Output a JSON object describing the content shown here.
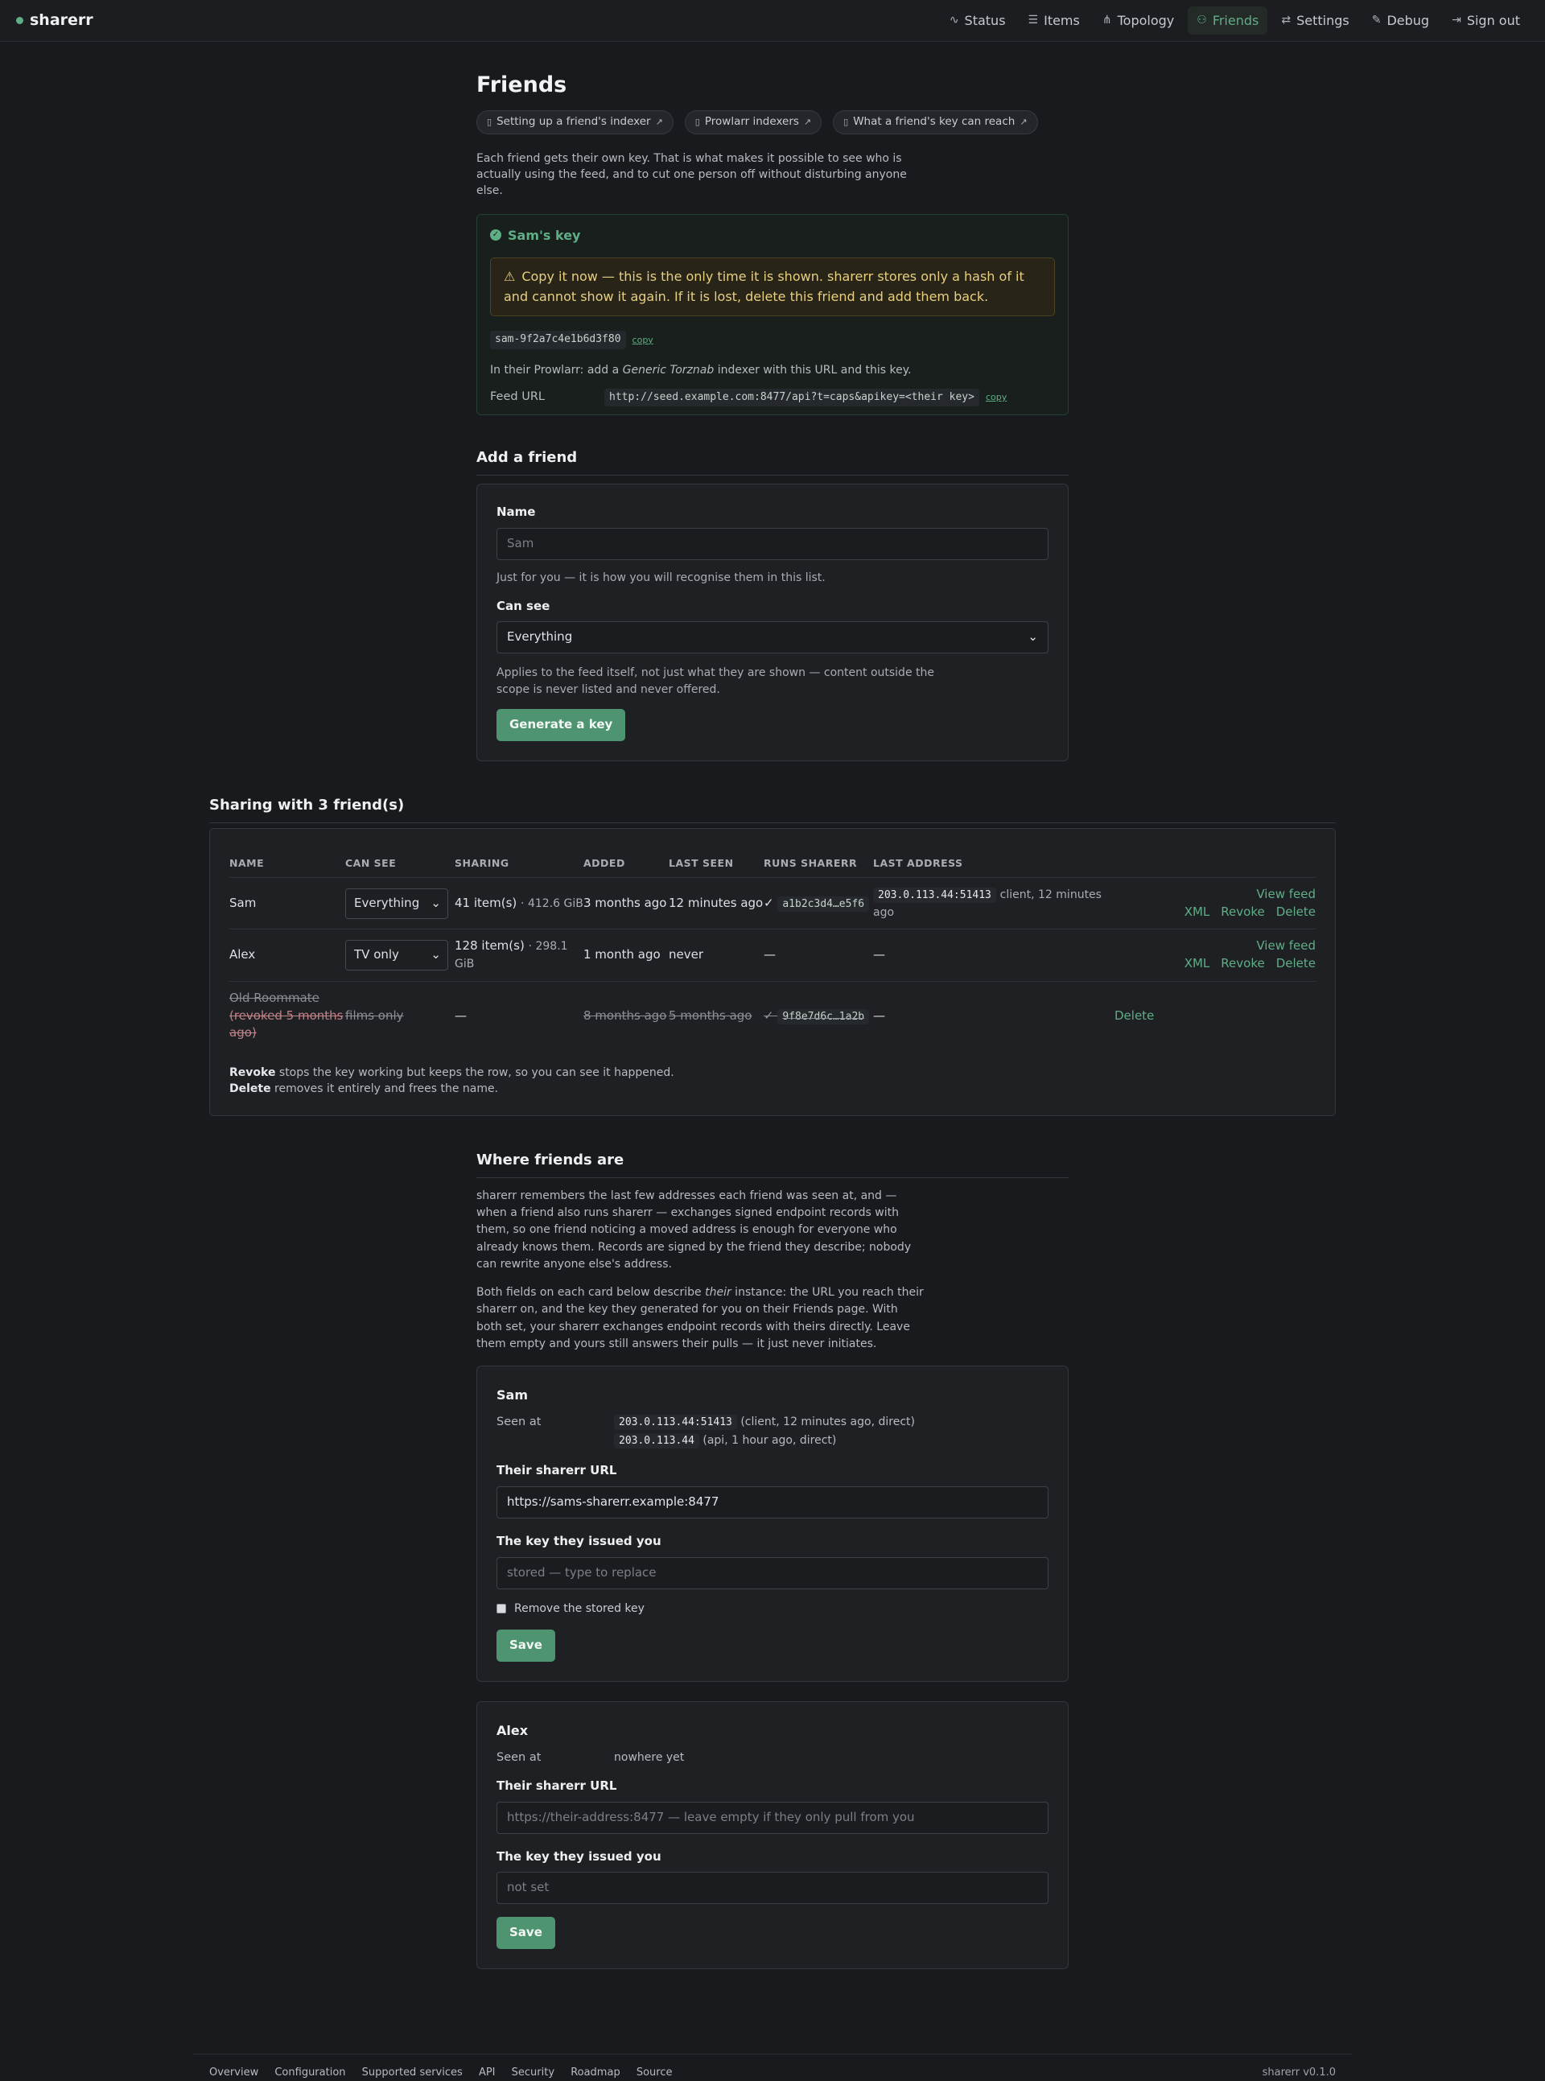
{
  "nav": {
    "brand": "sharerr",
    "links": [
      {
        "label": "Status",
        "icon": "pulse-icon"
      },
      {
        "label": "Items",
        "icon": "list-icon"
      },
      {
        "label": "Topology",
        "icon": "topology-icon"
      },
      {
        "label": "Friends",
        "icon": "friends-icon",
        "active": true
      },
      {
        "label": "Settings",
        "icon": "sliders-icon"
      },
      {
        "label": "Debug",
        "icon": "wrench-icon"
      },
      {
        "label": "Sign out",
        "icon": "sign-out-icon"
      }
    ]
  },
  "page": {
    "title": "Friends",
    "doc_chips": [
      "Setting up a friend's indexer",
      "Prowlarr indexers",
      "What a friend's key can reach"
    ],
    "intro": "Each friend gets their own key. That is what makes it possible to see who is actually using the feed, and to cut one person off without disturbing anyone else."
  },
  "new_key": {
    "title": "Sam's key",
    "warning": "Copy it now — this is the only time it is shown. sharerr stores only a hash of it and cannot show it again. If it is lost, delete this friend and add them back.",
    "key": "sam-9f2a7c4e1b6d3f80",
    "copy_label": "copy",
    "note_prefix": "In their Prowlarr: add a ",
    "note_em": "Generic Torznab",
    "note_suffix": " indexer with this URL and this key.",
    "feed_label": "Feed URL",
    "feed_url": "http://seed.example.com:8477/api?t=caps&apikey=<their key>",
    "feed_copy_label": "copy"
  },
  "add_friend": {
    "heading": "Add a friend",
    "name_label": "Name",
    "name_placeholder": "Sam",
    "name_help": "Just for you — it is how you will recognise them in this list.",
    "cansee_label": "Can see",
    "cansee_value": "Everything",
    "cansee_help": "Applies to the feed itself, not just what they are shown — content outside the scope is never listed and never offered.",
    "submit_label": "Generate a key"
  },
  "sharing": {
    "heading": "Sharing with 3 friend(s)",
    "columns": [
      "NAME",
      "CAN SEE",
      "SHARING",
      "ADDED",
      "LAST SEEN",
      "RUNS SHARERR",
      "LAST ADDRESS"
    ],
    "rows": [
      {
        "name": "Sam",
        "can_see": "Everything",
        "items": "41 item(s)",
        "size": "· 412.6 GiB",
        "added": "3 months ago",
        "last_seen": "12 minutes ago",
        "runs": "✓",
        "fingerprint": "a1b2c3d4…e5f6",
        "address": "203.0.113.44:51413",
        "address_note": "client, 12 minutes ago",
        "view": "View feed XML",
        "revoke": "Revoke",
        "delete": "Delete"
      },
      {
        "name": "Alex",
        "can_see": "TV only",
        "items": "128 item(s)",
        "size": "· 298.1 GiB",
        "added": "1 month ago",
        "last_seen": "never",
        "runs": "—",
        "address": "—",
        "view": "View feed XML",
        "revoke": "Revoke",
        "delete": "Delete"
      },
      {
        "name": "Old Roommate",
        "revoked_note": "(revoked 5 months ago)",
        "can_see": "films only",
        "sharing": "—",
        "added": "8 months ago",
        "last_seen": "5 months ago",
        "runs": "✓",
        "fingerprint": "9f8e7d6c…1a2b",
        "address": "—",
        "delete": "Delete"
      }
    ],
    "note_revoke": "Revoke",
    "note_mid": " stops the key working but keeps the row, so you can see it happened. ",
    "note_delete": "Delete",
    "note_end": " removes it entirely and frees the name."
  },
  "where": {
    "heading": "Where friends are",
    "p1": "sharerr remembers the last few addresses each friend was seen at, and — when a friend also runs sharerr — exchanges signed endpoint records with them, so one friend noticing a moved address is enough for everyone who already knows them. Records are signed by the friend they describe; nobody can rewrite anyone else's address.",
    "p2_a": "Both fields on each card below describe ",
    "p2_em": "their",
    "p2_b": " instance: the URL you reach their sharerr on, and the key they generated for you on their Friends page. With both set, your sharerr exchanges endpoint records with theirs directly. Leave them empty and yours still answers their pulls — it just never initiates.",
    "cards": [
      {
        "name": "Sam",
        "seen_label": "Seen at",
        "seen": [
          {
            "addr": "203.0.113.44:51413",
            "note": "(client, 12 minutes ago, direct)"
          },
          {
            "addr": "203.0.113.44",
            "note": "(api, 1 hour ago, direct)"
          }
        ],
        "url_label": "Their sharerr URL",
        "url_value": "https://sams-sharerr.example:8477",
        "key_label": "The key they issued you",
        "key_placeholder": "stored — type to replace",
        "remove_label": "Remove the stored key",
        "save_label": "Save"
      },
      {
        "name": "Alex",
        "seen_label": "Seen at",
        "seen_none": "nowhere yet",
        "url_label": "Their sharerr URL",
        "url_placeholder": "https://their-address:8477 — leave empty if they only pull from you",
        "key_label": "The key they issued you",
        "key_placeholder": "not set",
        "save_label": "Save"
      }
    ]
  },
  "footer": {
    "links": [
      "Overview",
      "Configuration",
      "Supported services",
      "API",
      "Security",
      "Roadmap",
      "Source"
    ],
    "version": "sharerr v0.1.0"
  },
  "colors": {
    "accent": "#5fae86",
    "warning": "#e7cf80",
    "background": "#181a1e"
  }
}
